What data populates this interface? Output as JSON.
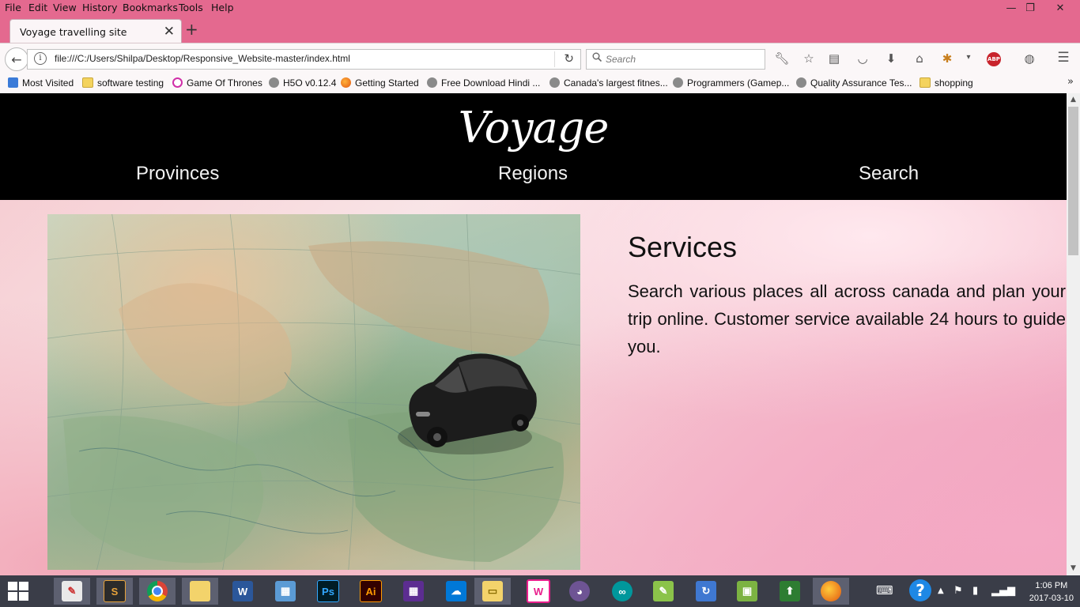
{
  "menu": {
    "file": "File",
    "edit": "Edit",
    "view": "View",
    "history": "History",
    "bookmarks": "Bookmarks",
    "tools": "Tools",
    "help": "Help"
  },
  "window": {
    "minimize": "—",
    "restore": "❐",
    "close": "✕"
  },
  "tab": {
    "title": "Voyage travelling site",
    "close": "✕",
    "new": "+"
  },
  "navbar": {
    "back": "←",
    "url": "file:///C:/Users/Shilpa/Desktop/Responsive_Website-master/index.html",
    "reload": "↻",
    "search_placeholder": "Search"
  },
  "bookmarks": [
    {
      "label": "Most Visited",
      "icon": "most-visited-icon"
    },
    {
      "label": "software testing",
      "icon": "folder-icon"
    },
    {
      "label": "Game Of Thrones",
      "icon": "site-icon"
    },
    {
      "label": "H5O v0.12.4",
      "icon": "globe-icon"
    },
    {
      "label": "Getting Started",
      "icon": "firefox-icon"
    },
    {
      "label": "Free Download Hindi ...",
      "icon": "globe-icon"
    },
    {
      "label": "Canada's largest fitnes...",
      "icon": "globe-icon"
    },
    {
      "label": "Programmers (Gamep...",
      "icon": "globe-icon"
    },
    {
      "label": "Quality Assurance Tes...",
      "icon": "globe-icon"
    },
    {
      "label": "shopping",
      "icon": "folder-icon"
    }
  ],
  "bookmarks_more": "»",
  "site": {
    "logo": "Voyage",
    "nav": [
      "Provinces",
      "Regions",
      "Search"
    ],
    "hero_image": "map-with-toy-car",
    "section_title": "Services",
    "section_text": "Search various places all across canada and plan your trip online. Customer service available 24 hours to guide you."
  },
  "taskbar": {
    "time": "1:06 PM",
    "date": "2017-03-10",
    "apps": [
      "photo-viewer",
      "sublime-text",
      "chrome",
      "file-explorer",
      "word",
      "calculator",
      "photoshop",
      "illustrator",
      "calendar",
      "onedrive",
      "folder",
      "pink-app",
      "github",
      "arduino",
      "notepad",
      "settings",
      "win-app",
      "green-arrow",
      "firefox"
    ]
  },
  "colors": {
    "chrome_bg": "#e4698f",
    "site_header": "#000000",
    "taskbar": "#3a3d48"
  }
}
